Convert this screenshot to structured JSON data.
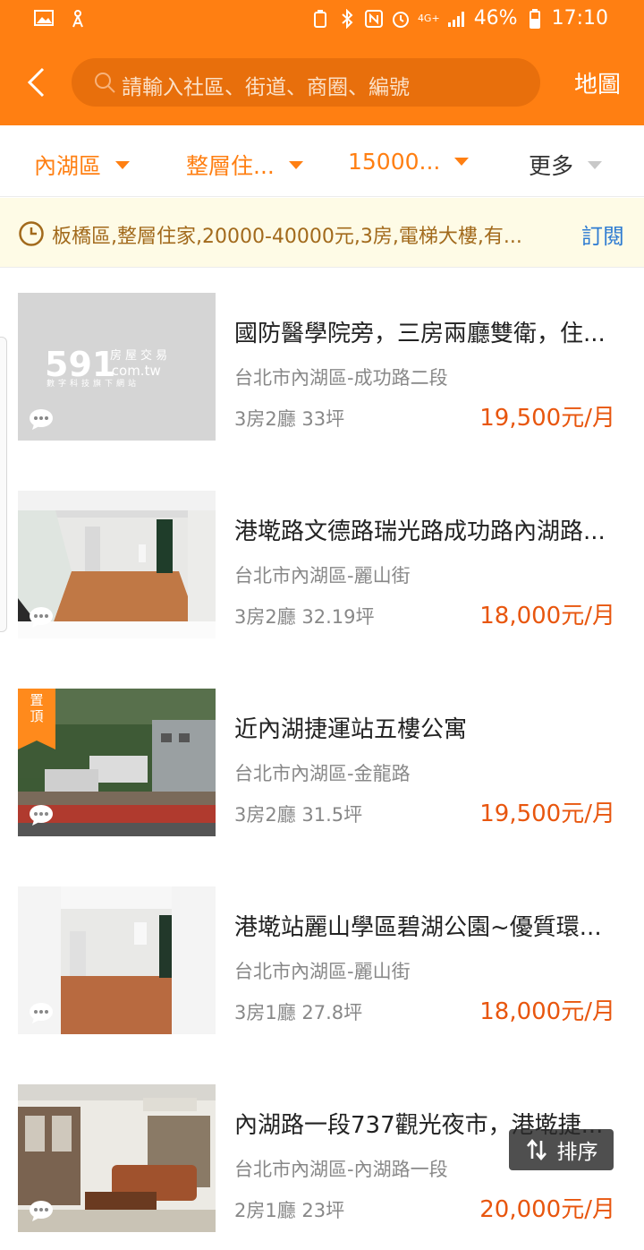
{
  "status_bar": {
    "battery": "46%",
    "time": "17:10",
    "network": "4G+"
  },
  "header": {
    "search_placeholder": "請輸入社區、街道、商圈、編號",
    "map_label": "地圖"
  },
  "filters": [
    {
      "label": "內湖區"
    },
    {
      "label": "整層住..."
    },
    {
      "label": "15000..."
    },
    {
      "label": "更多"
    }
  ],
  "subscription": {
    "text": "板橋區,整層住家,20000-40000元,3房,電梯大樓,有...",
    "action_label": "訂閱"
  },
  "listings": [
    {
      "title": "國防醫學院旁，三房兩廳雙衛，住...",
      "address": "台北市內湖區-成功路二段",
      "spec": "3房2廳  33坪",
      "price": "19,500元/月",
      "pinned": false,
      "logo_text": "591",
      "logo_sub": "房屋交易",
      "logo_url": ".com.tw",
      "logo_tag": "數字科技旗下網站"
    },
    {
      "title": "港墘路文德路瑞光路成功路內湖路...",
      "address": "台北市內湖區-麗山街",
      "spec": "3房2廳  32.19坪",
      "price": "18,000元/月",
      "pinned": false
    },
    {
      "title": "近內湖捷運站五樓公寓",
      "address": "台北市內湖區-金龍路",
      "spec": "3房2廳  31.5坪",
      "price": "19,500元/月",
      "pinned": true,
      "pin_label": "置頂"
    },
    {
      "title": "港墘站麗山學區碧湖公園~優質環...",
      "address": "台北市內湖區-麗山街",
      "spec": "3房1廳  27.8坪",
      "price": "18,000元/月",
      "pinned": false
    },
    {
      "title": "內湖路一段737觀光夜市，港墘捷...",
      "address": "台北市內湖區-內湖路一段",
      "spec": "2房1廳  23坪",
      "price": "20,000元/月",
      "pinned": false
    }
  ],
  "sort_button": {
    "label": "排序"
  },
  "colors": {
    "brand": "#ff7f12",
    "price": "#e8560e",
    "subscribe": "#2f7cd2"
  }
}
